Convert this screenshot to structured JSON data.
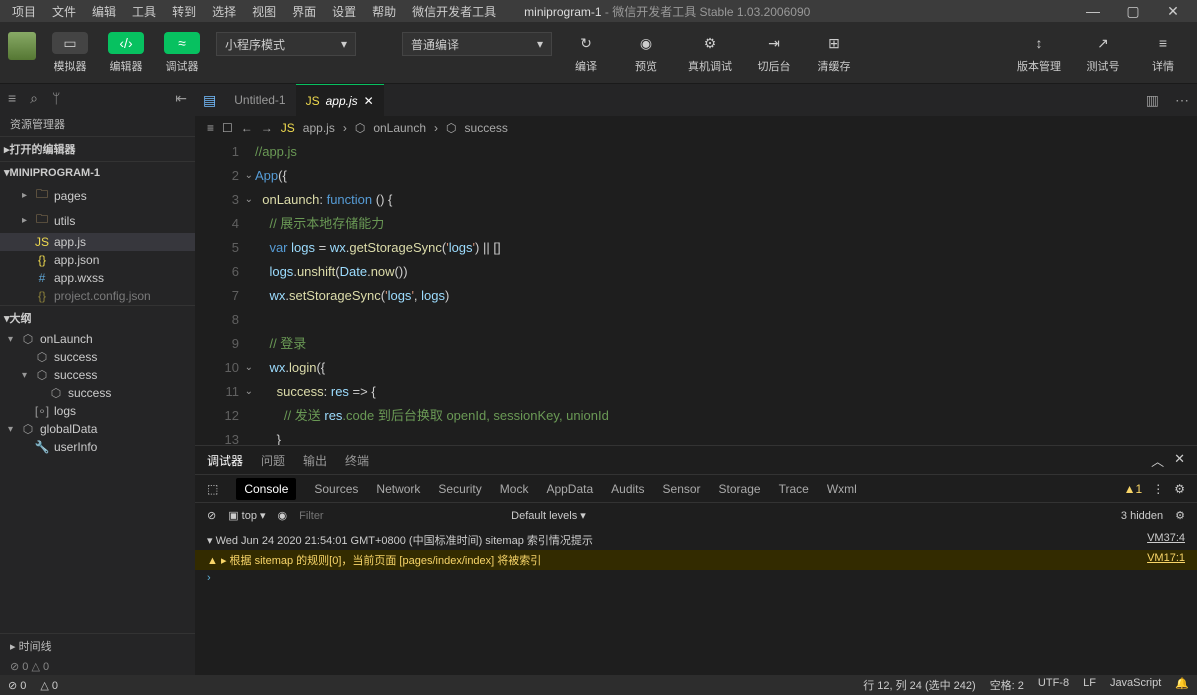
{
  "menubar": [
    "项目",
    "文件",
    "编辑",
    "工具",
    "转到",
    "选择",
    "视图",
    "界面",
    "设置",
    "帮助",
    "微信开发者工具"
  ],
  "title": {
    "name": "miniprogram-1",
    "suffix": " - 微信开发者工具 Stable 1.03.2006090"
  },
  "toolbar": {
    "simulator": "模拟器",
    "editor": "编辑器",
    "debugger": "调试器",
    "mode": "小程序模式",
    "compileMode": "普通编译",
    "compile": "编译",
    "preview": "预览",
    "remote": "真机调试",
    "background": "切后台",
    "clearCache": "清缓存",
    "versions": "版本管理",
    "testAccount": "测试号",
    "details": "详情"
  },
  "explorer": {
    "title": "资源管理器",
    "openEditors": "打开的编辑器",
    "project": "MINIPROGRAM-1",
    "tree": [
      {
        "icon": "folder",
        "label": "pages",
        "depth": 1,
        "chev": "▸"
      },
      {
        "icon": "folder",
        "label": "utils",
        "depth": 1,
        "chev": "▸"
      },
      {
        "icon": "js",
        "label": "app.js",
        "depth": 1,
        "active": true
      },
      {
        "icon": "json",
        "label": "app.json",
        "depth": 1
      },
      {
        "icon": "wxss",
        "label": "app.wxss",
        "depth": 1
      },
      {
        "icon": "json",
        "label": "project.config.json",
        "depth": 1,
        "faded": true
      }
    ],
    "outlineTitle": "大纲",
    "outline": [
      {
        "icon": "cube",
        "label": "onLaunch",
        "depth": 0,
        "chev": "▾"
      },
      {
        "icon": "cube",
        "label": "success",
        "depth": 1
      },
      {
        "icon": "cube",
        "label": "success",
        "depth": 1,
        "chev": "▾"
      },
      {
        "icon": "cube",
        "label": "success",
        "depth": 2
      },
      {
        "icon": "array",
        "label": "logs",
        "depth": 1
      },
      {
        "icon": "cube",
        "label": "globalData",
        "depth": 0,
        "chev": "▾"
      },
      {
        "icon": "wrench",
        "label": "userInfo",
        "depth": 1
      }
    ],
    "timeline": "时间线"
  },
  "tabs": [
    {
      "icon": "file",
      "label": "Untitled-1"
    },
    {
      "icon": "js",
      "label": "app.js",
      "active": true,
      "italic": true
    }
  ],
  "breadcrumb": [
    "app.js",
    "onLaunch",
    "success"
  ],
  "code": {
    "lines": [
      "//app.js",
      "App({",
      "  onLaunch: function () {",
      "    // 展示本地存储能力",
      "    var logs = wx.getStorageSync('logs') || []",
      "    logs.unshift(Date.now())",
      "    wx.setStorageSync('logs', logs)",
      "",
      "    // 登录",
      "    wx.login({",
      "      success: res => {",
      "        // 发送 res.code 到后台换取 openId, sessionKey, unionId",
      "      }"
    ],
    "start": 1
  },
  "bottomPanel": {
    "tabs": [
      "调试器",
      "问题",
      "输出",
      "终端"
    ],
    "devtabs": [
      "Console",
      "Sources",
      "Network",
      "Security",
      "Mock",
      "AppData",
      "Audits",
      "Sensor",
      "Storage",
      "Trace",
      "Wxml"
    ],
    "warnBadge": "1",
    "hidden": "3 hidden",
    "contextTop": "top",
    "filterPlaceholder": "Filter",
    "levels": "Default levels ▾",
    "logs": [
      {
        "type": "info",
        "text": "▾ Wed Jun 24 2020 21:54:01 GMT+0800 (中国标准时间) sitemap 索引情况提示",
        "link": "VM37:4"
      },
      {
        "type": "warn",
        "text": "▲ ▸ 根据 sitemap 的规则[0]，当前页面 [pages/index/index] 将被索引",
        "link": "VM17:1"
      }
    ],
    "prompt": "›"
  },
  "statusbar": {
    "errors": "⊘ 0",
    "warnings": "△ 0",
    "pos": "行 12, 列 24 (选中 242)",
    "spaces": "空格: 2",
    "enc": "UTF-8",
    "eol": "LF",
    "lang": "JavaScript"
  }
}
